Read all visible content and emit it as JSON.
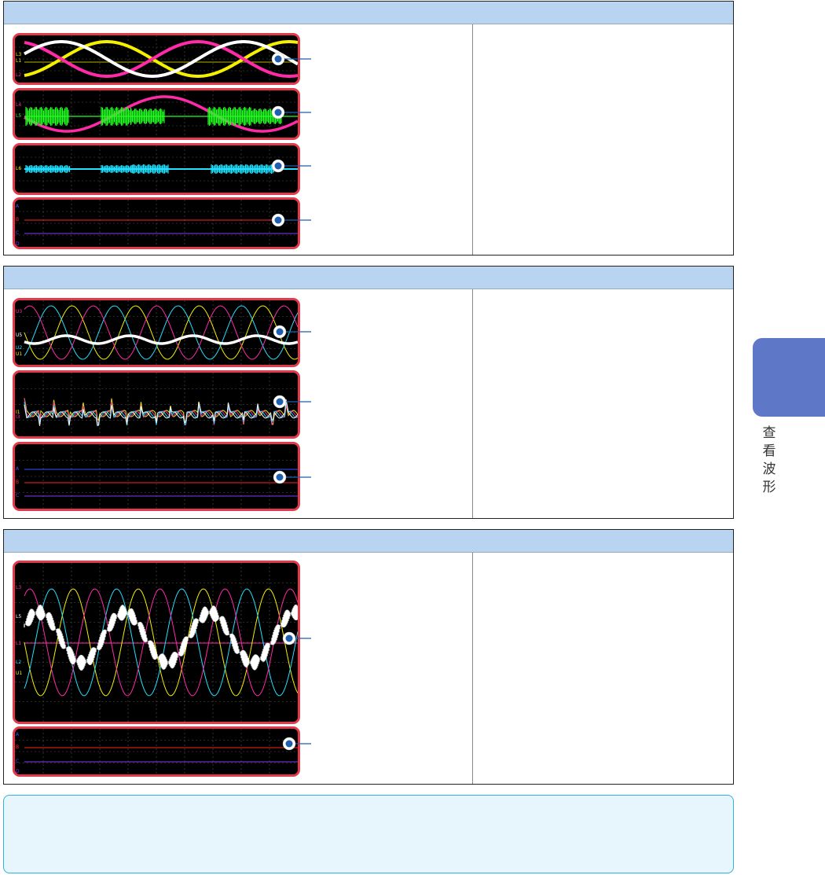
{
  "side_tab": {
    "label_chars": [
      "查",
      "看",
      "波",
      "形"
    ],
    "color": "#5e77c6"
  },
  "colors": {
    "header_bg": "#b9d4f1",
    "panel_border": "#e23a4a",
    "callout_dot": "#1f5fae",
    "note_border": "#2fb2d9",
    "note_bg": "#e7f6fc",
    "trace_yellow": "#f5f000",
    "trace_magenta": "#ff2aa8",
    "trace_cyan": "#22e0ff",
    "trace_green": "#22ff22",
    "trace_white": "#ffffff",
    "trace_blue": "#3355ff",
    "trace_red": "#ff2222",
    "trace_violet": "#8833ff"
  },
  "sections": [
    {
      "panels": [
        {
          "labels": [
            "L3",
            "L1",
            "L2"
          ]
        },
        {
          "labels": [
            "L4",
            "L5"
          ]
        },
        {
          "labels": [
            "L6"
          ]
        },
        {
          "labels": [
            "A",
            "B",
            "C",
            "D"
          ]
        }
      ]
    },
    {
      "panels": [
        {
          "labels": [
            "U3",
            "U5",
            "U2",
            "U1"
          ]
        },
        {
          "labels": [
            "I1",
            "I3"
          ]
        },
        {
          "labels": [
            "A",
            "B",
            "C"
          ]
        }
      ]
    },
    {
      "panels": [
        {
          "labels": [
            "L3",
            "L5",
            "L1",
            "L2",
            "U1"
          ]
        },
        {
          "labels": [
            "A",
            "B",
            "C",
            "D"
          ]
        }
      ]
    }
  ]
}
